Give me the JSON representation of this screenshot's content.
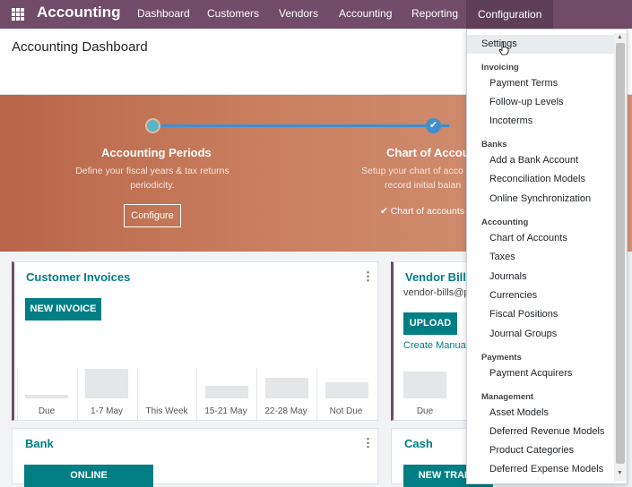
{
  "navbar": {
    "brand": "Accounting",
    "items": [
      "Dashboard",
      "Customers",
      "Vendors",
      "Accounting",
      "Reporting",
      "Configuration"
    ]
  },
  "page": {
    "title": "Accounting Dashboard"
  },
  "banner": {
    "steps": [
      {
        "title": "Accounting Periods",
        "desc1": "Define your fiscal years & tax returns",
        "desc2": "periodicity.",
        "button": "Configure"
      },
      {
        "title": "Chart of Accour",
        "desc1": "Setup your chart of acco",
        "desc2": "record initial balan",
        "done": "Chart of accounts"
      }
    ]
  },
  "cards": {
    "customer_invoices": {
      "title": "Customer Invoices",
      "button": "NEW INVOICE",
      "chart_labels": [
        "Due",
        "1-7 May",
        "This Week",
        "15-21 May",
        "22-28 May",
        "Not Due"
      ]
    },
    "vendor_bills": {
      "title": "Vendor Bills",
      "email": "vendor-bills@p",
      "button": "UPLOAD",
      "link": "Create Manual",
      "chart_labels": [
        "Due"
      ]
    },
    "bank": {
      "title": "Bank",
      "button": "ONLINE"
    },
    "cash": {
      "title": "Cash",
      "button": "NEW TRANS"
    }
  },
  "dropdown": {
    "settings": "Settings",
    "sections": [
      {
        "header": "Invoicing",
        "items": [
          "Payment Terms",
          "Follow-up Levels",
          "Incoterms"
        ]
      },
      {
        "header": "Banks",
        "items": [
          "Add a Bank Account",
          "Reconciliation Models",
          "Online Synchronization"
        ]
      },
      {
        "header": "Accounting",
        "items": [
          "Chart of Accounts",
          "Taxes",
          "Journals",
          "Currencies",
          "Fiscal Positions",
          "Journal Groups"
        ]
      },
      {
        "header": "Payments",
        "items": [
          "Payment Acquirers"
        ]
      },
      {
        "header": "Management",
        "items": [
          "Asset Models",
          "Deferred Revenue Models",
          "Product Categories",
          "Deferred Expense Models"
        ]
      }
    ]
  },
  "colors": {
    "navbar": "#714b67",
    "primary": "#017e84"
  }
}
